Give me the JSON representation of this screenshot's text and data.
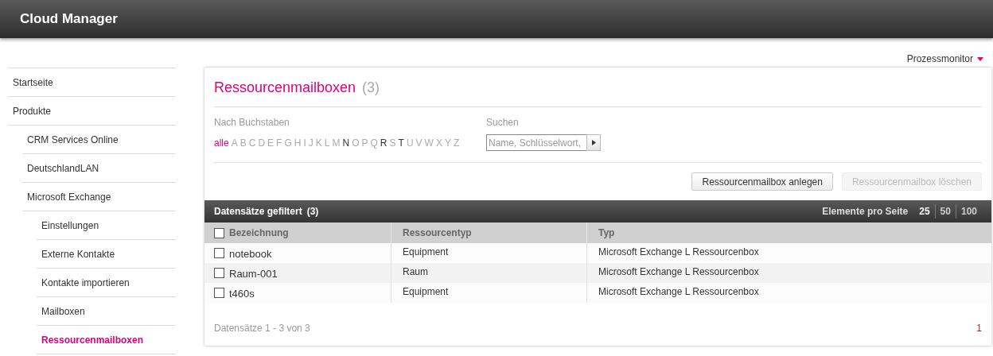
{
  "header": {
    "title": "Cloud Manager"
  },
  "process_monitor": {
    "label": "Prozessmonitor"
  },
  "sidebar": {
    "items": [
      {
        "label": "Startseite",
        "selected": false
      },
      {
        "label": "Produkte",
        "selected": false,
        "children": [
          {
            "label": "CRM Services Online",
            "selected": false
          },
          {
            "label": "DeutschlandLAN",
            "selected": false
          },
          {
            "label": "Microsoft Exchange",
            "selected": false,
            "children": [
              {
                "label": "Einstellungen",
                "selected": false
              },
              {
                "label": "Externe Kontakte",
                "selected": false
              },
              {
                "label": "Kontakte importieren",
                "selected": false
              },
              {
                "label": "Mailboxen",
                "selected": false
              },
              {
                "label": "Ressourcenmailboxen",
                "selected": true
              }
            ]
          }
        ]
      }
    ]
  },
  "page": {
    "title": "Ressourcenmailboxen",
    "count": "(3)"
  },
  "letter_filter": {
    "label": "Nach Buchstaben",
    "letters": [
      {
        "label": "alle",
        "selected": true,
        "enabled": true
      },
      {
        "label": "A",
        "selected": false,
        "enabled": false
      },
      {
        "label": "B",
        "selected": false,
        "enabled": false
      },
      {
        "label": "C",
        "selected": false,
        "enabled": false
      },
      {
        "label": "D",
        "selected": false,
        "enabled": false
      },
      {
        "label": "E",
        "selected": false,
        "enabled": false
      },
      {
        "label": "F",
        "selected": false,
        "enabled": false
      },
      {
        "label": "G",
        "selected": false,
        "enabled": false
      },
      {
        "label": "H",
        "selected": false,
        "enabled": false
      },
      {
        "label": "I",
        "selected": false,
        "enabled": false
      },
      {
        "label": "J",
        "selected": false,
        "enabled": false
      },
      {
        "label": "K",
        "selected": false,
        "enabled": false
      },
      {
        "label": "L",
        "selected": false,
        "enabled": false
      },
      {
        "label": "M",
        "selected": false,
        "enabled": false
      },
      {
        "label": "N",
        "selected": false,
        "enabled": true
      },
      {
        "label": "O",
        "selected": false,
        "enabled": false
      },
      {
        "label": "P",
        "selected": false,
        "enabled": false
      },
      {
        "label": "Q",
        "selected": false,
        "enabled": false
      },
      {
        "label": "R",
        "selected": false,
        "enabled": true
      },
      {
        "label": "S",
        "selected": false,
        "enabled": false
      },
      {
        "label": "T",
        "selected": false,
        "enabled": true
      },
      {
        "label": "U",
        "selected": false,
        "enabled": false
      },
      {
        "label": "V",
        "selected": false,
        "enabled": false
      },
      {
        "label": "W",
        "selected": false,
        "enabled": false
      },
      {
        "label": "X",
        "selected": false,
        "enabled": false
      },
      {
        "label": "Y",
        "selected": false,
        "enabled": false
      },
      {
        "label": "Z",
        "selected": false,
        "enabled": false
      }
    ]
  },
  "search": {
    "label": "Suchen",
    "placeholder": "Name, Schlüsselwort,"
  },
  "actions": [
    {
      "label": "Ressourcenmailbox anlegen",
      "disabled": false
    },
    {
      "label": "Ressourcenmailbox löschen",
      "disabled": true
    }
  ],
  "table_bar": {
    "title": "Datensätze gefiltert",
    "count": "(3)",
    "per_page_label": "Elemente pro Seite",
    "per_page_options": [
      {
        "label": "25",
        "selected": true
      },
      {
        "label": "50",
        "selected": false
      },
      {
        "label": "100",
        "selected": false
      }
    ]
  },
  "table": {
    "columns": [
      "Bezeichnung",
      "Ressourcentyp",
      "Typ"
    ],
    "header_checked": false,
    "rows": [
      {
        "checked": false,
        "cells": [
          "notebook",
          "Equipment",
          "Microsoft Exchange L Ressourcenbox"
        ]
      },
      {
        "checked": false,
        "cells": [
          "Raum-001",
          "Raum",
          "Microsoft Exchange L Ressourcenbox"
        ]
      },
      {
        "checked": false,
        "cells": [
          "t460s",
          "Equipment",
          "Microsoft Exchange L Ressourcenbox"
        ]
      }
    ]
  },
  "footer": {
    "records": "Datensätze 1 - 3 von 3",
    "pages": [
      {
        "label": "1",
        "selected": true
      }
    ]
  }
}
